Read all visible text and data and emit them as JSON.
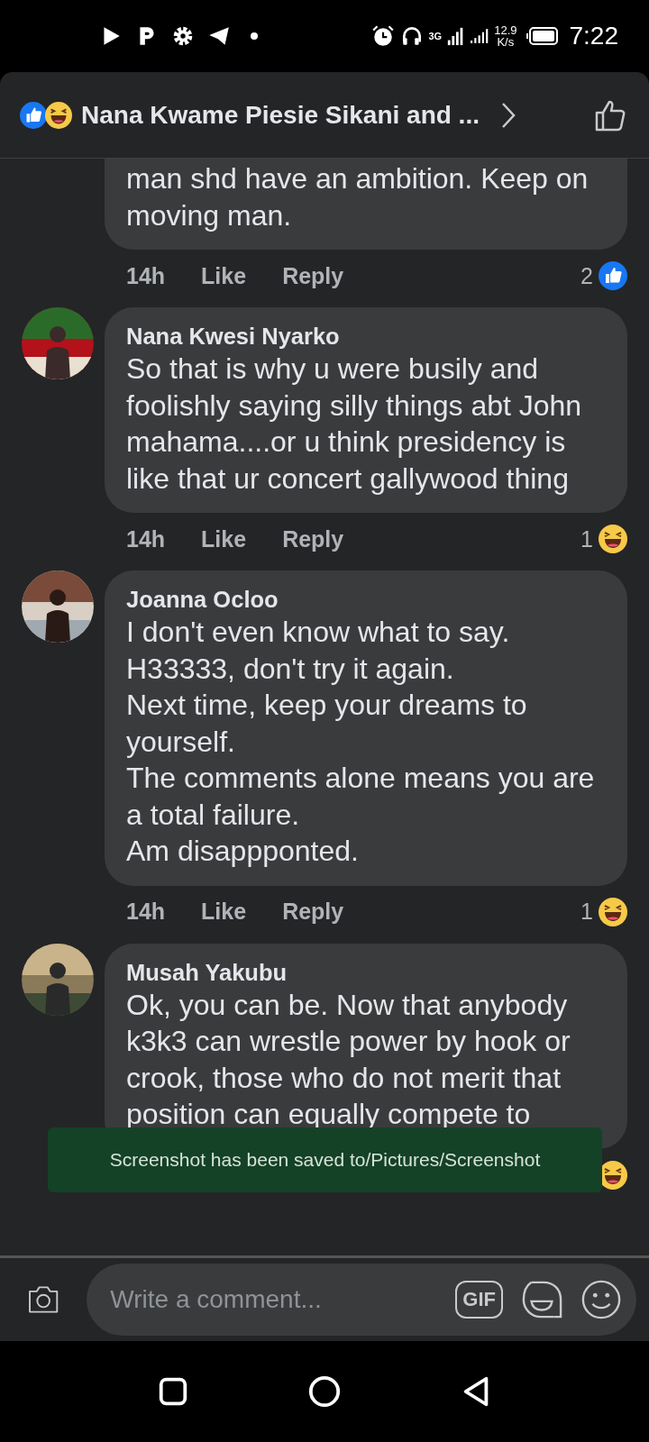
{
  "status_bar": {
    "network": "3G",
    "speed": "12.9",
    "speed_unit": "K/s",
    "time": "7:22"
  },
  "header": {
    "reactions": [
      {
        "kind": "like"
      },
      {
        "kind": "haha"
      }
    ],
    "title": "Nana Kwame Piesie Sikani and ..."
  },
  "comments": [
    {
      "text": "man shd have an ambition. Keep on moving man.",
      "time": "14h",
      "like": "Like",
      "reply": "Reply",
      "reaction": {
        "count": "2",
        "kind": "like"
      }
    },
    {
      "author": "Nana Kwesi Nyarko",
      "text": "So that is why u were busily and foolishly saying silly things abt John mahama....or u think presidency is like that ur concert gallywood thing",
      "time": "14h",
      "like": "Like",
      "reply": "Reply",
      "reaction": {
        "count": "1",
        "kind": "haha"
      }
    },
    {
      "author": "Joanna Ocloo",
      "text": "I don't even know what to say.\nH33333, don't try it again.\nNext time, keep your dreams to yourself.\nThe comments alone means you are a total failure.\nAm disappponted.",
      "time": "14h",
      "like": "Like",
      "reply": "Reply",
      "reaction": {
        "count": "1",
        "kind": "haha"
      }
    },
    {
      "author": "Musah Yakubu",
      "text": "Ok, you can be. Now that anybody k3k3 can wrestle power by hook or crook, those who do not merit that position can equally compete to",
      "reaction": {
        "kind": "haha"
      }
    }
  ],
  "toast": "Screenshot has been saved to/Pictures/Screenshot",
  "composer": {
    "placeholder": "Write a comment...",
    "gif": "GIF"
  }
}
